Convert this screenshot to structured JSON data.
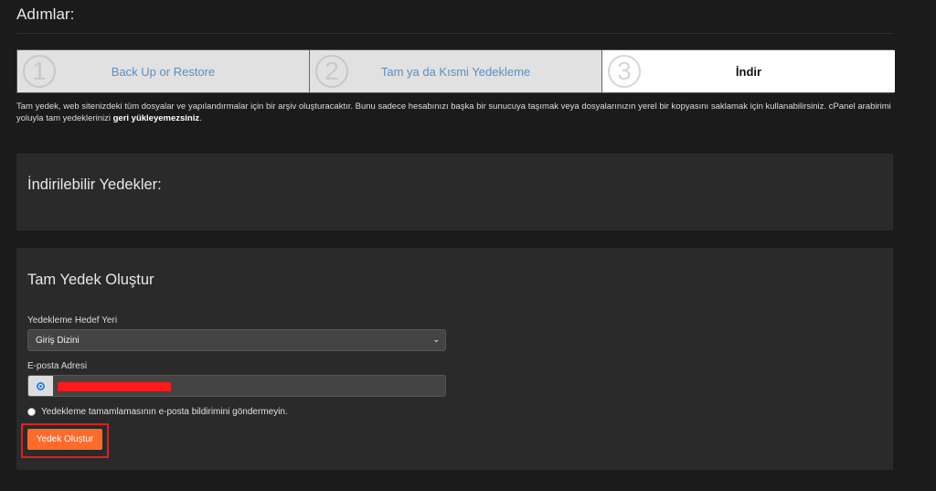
{
  "page": {
    "title": "Adımlar:"
  },
  "steps": [
    {
      "number": "1",
      "label": "Back Up or Restore",
      "active": false
    },
    {
      "number": "2",
      "label": "Tam ya da Kısmi Yedekleme",
      "active": false
    },
    {
      "number": "3",
      "label": "İndir",
      "active": true
    }
  ],
  "description": {
    "text": "Tam yedek, web sitenizdeki tüm dosyalar ve yapılandırmalar için bir arşiv oluşturacaktır. Bunu sadece hesabınızı başka bir sunucuya taşımak veya dosyalarınızın yerel bir kopyasını saklamak için kullanabilirsiniz. cPanel arabirimi yoluyla tam yedeklerinizi ",
    "bold": "geri yükleyemezsiniz",
    "end": "."
  },
  "downloads": {
    "title": "İndirilebilir Yedekler:"
  },
  "create": {
    "title": "Tam Yedek Oluştur",
    "destination_label": "Yedekleme Hedef Yeri",
    "destination_value": "Giriş Dizini",
    "email_label": "E-posta Adresi",
    "email_value": "",
    "no_notify_label": "Yedekleme tamamlamasının e-posta bildirimini göndermeyin.",
    "button_label": "Yedek Oluştur"
  },
  "colors": {
    "accent": "#ff6b2b",
    "link": "#5a8fc1",
    "highlight": "#e02020",
    "redaction": "#ff1a1a"
  }
}
